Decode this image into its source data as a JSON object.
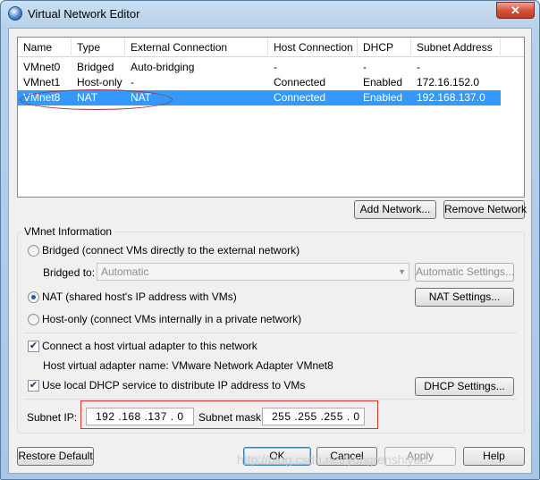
{
  "window": {
    "title": "Virtual Network Editor",
    "close_glyph": "✕",
    "icon": "globe-icon"
  },
  "table": {
    "columns": [
      "Name",
      "Type",
      "External Connection",
      "Host Connection",
      "DHCP",
      "Subnet Address"
    ],
    "rows": [
      {
        "name": "VMnet0",
        "type": "Bridged",
        "external": "Auto-bridging",
        "host": "-",
        "dhcp": "-",
        "subnet": "-"
      },
      {
        "name": "VMnet1",
        "type": "Host-only",
        "external": "-",
        "host": "Connected",
        "dhcp": "Enabled",
        "subnet": "172.16.152.0"
      },
      {
        "name": "VMnet8",
        "type": "NAT",
        "external": "NAT",
        "host": "Connected",
        "dhcp": "Enabled",
        "subnet": "192.168.137.0"
      }
    ],
    "selected_row": 2
  },
  "buttons": {
    "add_network": "Add Network...",
    "remove_network": "Remove Network",
    "automatic_settings": "Automatic Settings...",
    "nat_settings": "NAT Settings...",
    "dhcp_settings": "DHCP Settings...",
    "restore_default": "Restore Default",
    "ok": "OK",
    "cancel": "Cancel",
    "apply": "Apply",
    "help": "Help"
  },
  "vmnet_info": {
    "group_label": "VMnet Information",
    "bridged_label": "Bridged (connect VMs directly to the external network)",
    "bridged_to_label": "Bridged to:",
    "bridged_to_value": "Automatic",
    "nat_label": "NAT (shared host's IP address with VMs)",
    "hostonly_label": "Host-only (connect VMs internally in a private network)",
    "connect_adapter_label": "Connect a host virtual adapter to this network",
    "adapter_name_text": "Host virtual adapter name: VMware Network Adapter VMnet8",
    "dhcp_label": "Use local DHCP service to distribute IP address to VMs",
    "subnet_ip_label": "Subnet IP:",
    "subnet_ip": "192 .168 .137 . 0",
    "subnet_mask_label": "Subnet mask:",
    "subnet_mask": "255 .255 .255 . 0",
    "selected_mode": "nat",
    "connect_adapter_checked": true,
    "dhcp_checked": true
  },
  "watermark": "http://blog.csdn.net/yongrenshiyao",
  "colors": {
    "selection": "#3399ff",
    "highlight_ellipse": "#a0304a",
    "highlight_box": "#d83232"
  }
}
